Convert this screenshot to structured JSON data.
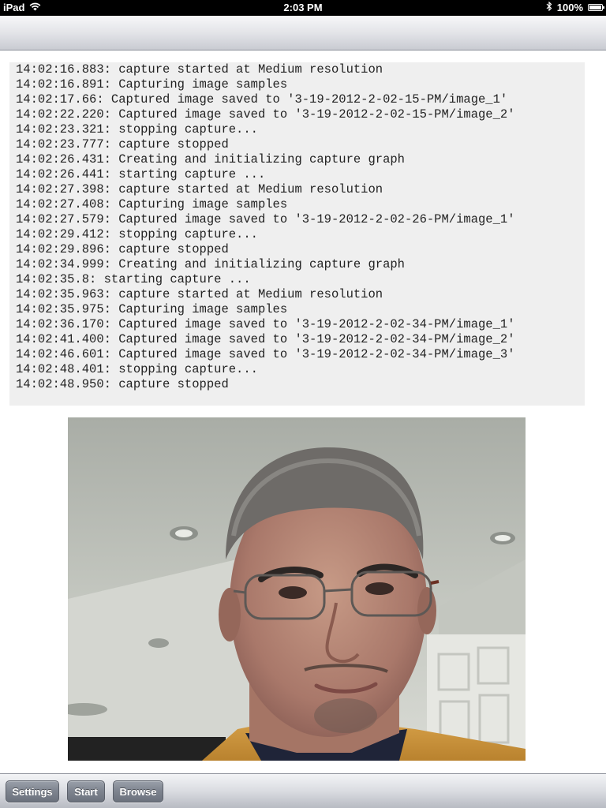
{
  "status_bar": {
    "carrier": "iPad",
    "time": "2:03 PM",
    "battery": "100%",
    "icons": [
      "wifi-icon",
      "bluetooth-icon",
      "battery-icon"
    ]
  },
  "log": {
    "lines": [
      "14:02:16.883: capture started at Medium resolution",
      "14:02:16.891: Capturing image samples",
      "14:02:17.66: Captured image saved to '3-19-2012-2-02-15-PM/image_1'",
      "14:02:22.220: Captured image saved to '3-19-2012-2-02-15-PM/image_2'",
      "14:02:23.321: stopping capture...",
      "14:02:23.777: capture stopped",
      "14:02:26.431: Creating and initializing capture graph",
      "14:02:26.441: starting capture ...",
      "14:02:27.398: capture started at Medium resolution",
      "14:02:27.408: Capturing image samples",
      "14:02:27.579: Captured image saved to '3-19-2012-2-02-26-PM/image_1'",
      "14:02:29.412: stopping capture...",
      "14:02:29.896: capture stopped",
      "14:02:34.999: Creating and initializing capture graph",
      "14:02:35.8: starting capture ...",
      "14:02:35.963: capture started at Medium resolution",
      "14:02:35.975: Capturing image samples",
      "14:02:36.170: Captured image saved to '3-19-2012-2-02-34-PM/image_1'",
      "14:02:41.400: Captured image saved to '3-19-2012-2-02-34-PM/image_2'",
      "14:02:46.601: Captured image saved to '3-19-2012-2-02-34-PM/image_3'",
      "14:02:48.401: stopping capture...",
      "14:02:48.950: capture stopped"
    ]
  },
  "toolbar": {
    "settings_label": "Settings",
    "start_label": "Start",
    "browse_label": "Browse"
  }
}
